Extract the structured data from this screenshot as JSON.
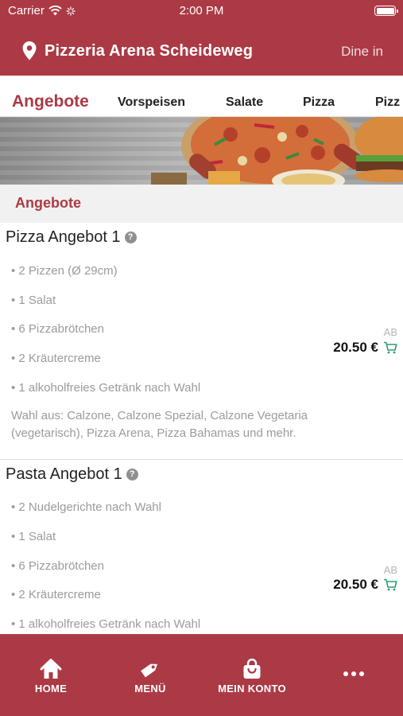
{
  "status_bar": {
    "carrier": "Carrier",
    "time": "2:00 PM"
  },
  "header": {
    "restaurant": "Pizzeria Arena Scheideweg",
    "mode": "Dine in"
  },
  "tabs": [
    {
      "label": "Angebote",
      "active": true
    },
    {
      "label": "Vorspeisen",
      "active": false
    },
    {
      "label": "Salate",
      "active": false
    },
    {
      "label": "Pizza",
      "active": false
    },
    {
      "label": "Pizz",
      "active": false
    }
  ],
  "section": {
    "title": "Angebote"
  },
  "items": [
    {
      "title": "Pizza Angebot 1",
      "lines": [
        "• 2 Pizzen (Ø 29cm)",
        "• 1 Salat",
        "• 6 Pizzabrötchen",
        "• 2 Kräutercreme",
        "• 1 alkoholfreies Getränk nach Wahl"
      ],
      "description_lines": [
        "Wahl aus: Calzone, Calzone Spezial, Calzone Vegetaria",
        "(vegetarisch), Pizza Arena, Pizza Bahamas und mehr."
      ],
      "price_prefix": "AB",
      "price": "20.50 €"
    },
    {
      "title": "Pasta Angebot 1",
      "lines": [
        "• 2 Nudelgerichte nach Wahl",
        "• 1 Salat",
        "• 6 Pizzabrötchen",
        "• 2 Kräutercreme",
        "• 1 alkoholfreies Getränk nach Wahl"
      ],
      "price_prefix": "AB",
      "price": "20.50 €"
    }
  ],
  "bottom_nav": [
    {
      "label": "HOME",
      "icon": "home-icon"
    },
    {
      "label": "MENÜ",
      "icon": "tag-icon"
    },
    {
      "label": "MEIN KONTO",
      "icon": "shopping-bag-icon"
    },
    {
      "label": "",
      "icon": "more-dots-icon"
    }
  ],
  "colors": {
    "brand": "#ab3a45",
    "section_bg": "#f1f1f1",
    "cart_icon": "#2e9e6b"
  }
}
